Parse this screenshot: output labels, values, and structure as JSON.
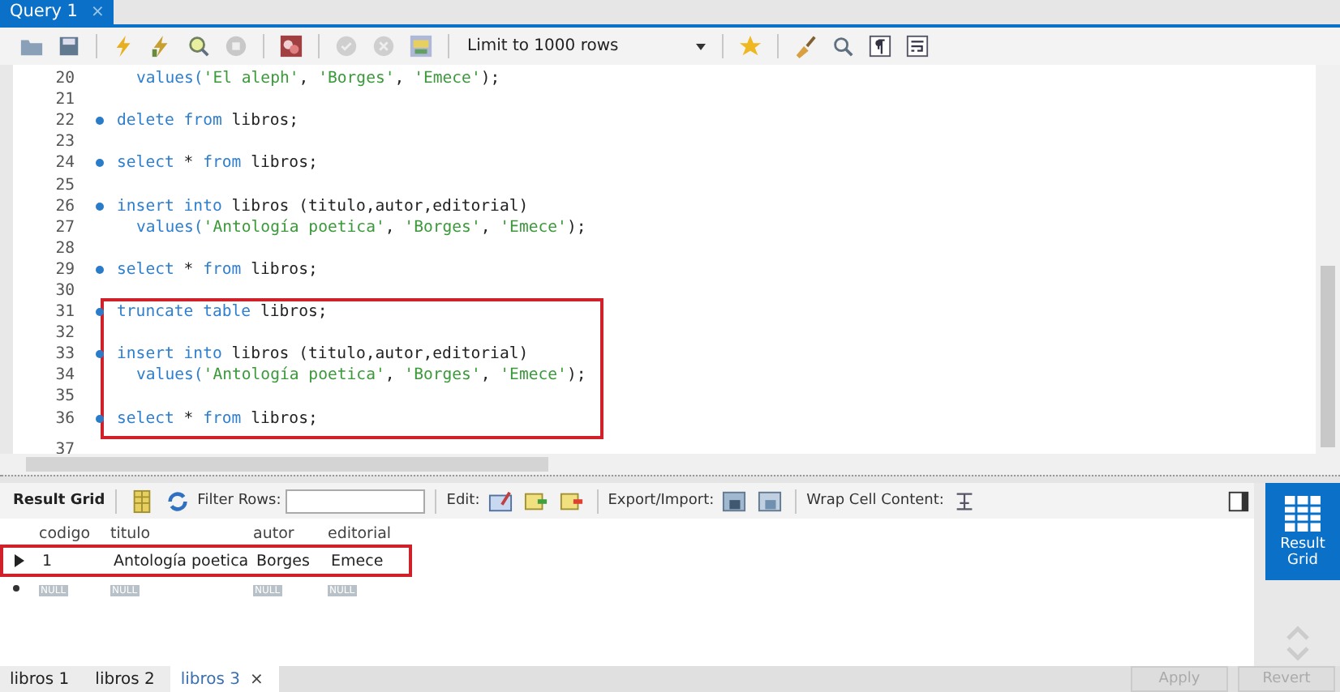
{
  "query_tab": {
    "label": "Query 1",
    "close": "×",
    "selected": true
  },
  "toolbar": {
    "limit": "Limit to 1000 rows"
  },
  "editor": {
    "blocks": [
      {
        "boxed": false,
        "lines": [
          {
            "number": "20",
            "marker": false,
            "indented": true,
            "tokens": [
              {
                "text": "values(",
                "kind": "keyword"
              },
              {
                "text": "'El aleph'",
                "kind": "string"
              },
              {
                "text": ", ",
                "kind": "plain"
              },
              {
                "text": "'Borges'",
                "kind": "string"
              },
              {
                "text": ", ",
                "kind": "plain"
              },
              {
                "text": "'Emece'",
                "kind": "string"
              },
              {
                "text": ");",
                "kind": "plain"
              }
            ]
          },
          {
            "number": "21",
            "marker": false
          },
          {
            "number": "22",
            "marker": true,
            "indented": false,
            "tokens": [
              {
                "text": "delete from",
                "kind": "keyword"
              },
              {
                "text": " libros;",
                "kind": "plain"
              }
            ]
          },
          {
            "number": "23",
            "marker": false
          },
          {
            "number": "24",
            "marker": true,
            "indented": false,
            "tokens": [
              {
                "text": "select",
                "kind": "keyword"
              },
              {
                "text": " * ",
                "kind": "plain"
              },
              {
                "text": "from",
                "kind": "keyword"
              },
              {
                "text": " libros;",
                "kind": "plain"
              }
            ]
          },
          {
            "number": "25",
            "marker": false
          },
          {
            "number": "26",
            "marker": true,
            "indented": false,
            "tokens": [
              {
                "text": "insert into",
                "kind": "keyword"
              },
              {
                "text": " libros (titulo,autor,editorial)",
                "kind": "plain"
              }
            ]
          },
          {
            "number": "27",
            "marker": false,
            "indented": true,
            "tokens": [
              {
                "text": "values(",
                "kind": "keyword"
              },
              {
                "text": "'Antología poetica'",
                "kind": "string"
              },
              {
                "text": ", ",
                "kind": "plain"
              },
              {
                "text": "'Borges'",
                "kind": "string"
              },
              {
                "text": ", ",
                "kind": "plain"
              },
              {
                "text": "'Emece'",
                "kind": "string"
              },
              {
                "text": ");",
                "kind": "plain"
              }
            ]
          },
          {
            "number": "28",
            "marker": false
          },
          {
            "number": "29",
            "marker": true,
            "indented": false,
            "tokens": [
              {
                "text": "select",
                "kind": "keyword"
              },
              {
                "text": " * ",
                "kind": "plain"
              },
              {
                "text": "from",
                "kind": "keyword"
              },
              {
                "text": " libros;",
                "kind": "plain"
              }
            ]
          },
          {
            "number": "30",
            "marker": false
          }
        ]
      },
      {
        "boxed": true,
        "lines": [
          {
            "number": "31",
            "marker": true,
            "indented": false,
            "tokens": [
              {
                "text": "truncate table",
                "kind": "keyword"
              },
              {
                "text": " libros;",
                "kind": "plain"
              }
            ]
          },
          {
            "number": "32",
            "marker": false
          },
          {
            "number": "33",
            "marker": true,
            "indented": false,
            "tokens": [
              {
                "text": "insert into",
                "kind": "keyword"
              },
              {
                "text": " libros (titulo,autor,editorial)",
                "kind": "plain"
              }
            ]
          },
          {
            "number": "34",
            "marker": false,
            "indented": true,
            "tokens": [
              {
                "text": "values(",
                "kind": "keyword"
              },
              {
                "text": "'Antología poetica'",
                "kind": "string"
              },
              {
                "text": ", ",
                "kind": "plain"
              },
              {
                "text": "'Borges'",
                "kind": "string"
              },
              {
                "text": ", ",
                "kind": "plain"
              },
              {
                "text": "'Emece'",
                "kind": "string"
              },
              {
                "text": ");",
                "kind": "plain"
              }
            ]
          },
          {
            "number": "35",
            "marker": false
          },
          {
            "number": "36",
            "marker": true,
            "indented": false,
            "tokens": [
              {
                "text": "select",
                "kind": "keyword"
              },
              {
                "text": " * ",
                "kind": "plain"
              },
              {
                "text": "from",
                "kind": "keyword"
              },
              {
                "text": " libros;",
                "kind": "plain"
              }
            ]
          }
        ]
      },
      {
        "boxed": false,
        "lines": [
          {
            "number": "37",
            "marker": false
          }
        ]
      }
    ]
  },
  "result_toolbar": {
    "title": "Result Grid",
    "filter_label": "Filter Rows:",
    "edit_label": "Edit:",
    "export_label": "Export/Import:",
    "wrap_label": "Wrap Cell Content:"
  },
  "grid": {
    "columns": [
      "codigo",
      "titulo",
      "autor",
      "editorial"
    ],
    "rows": [
      {
        "boxed": true,
        "cells": [
          "1",
          "Antología poetica",
          "Borges",
          "Emece"
        ]
      }
    ],
    "new_row": {
      "cells": [
        "NULL",
        "NULL",
        "NULL",
        "NULL"
      ]
    }
  },
  "side_panel": {
    "label": "Result Grid"
  },
  "result_tabs": [
    {
      "label": "libros 1",
      "selected": false,
      "closable": false
    },
    {
      "label": "libros 2",
      "selected": false,
      "closable": false
    },
    {
      "label": "libros 3",
      "selected": true,
      "closable": true
    }
  ],
  "close_glyph": "×",
  "buttons": [
    {
      "label": "Apply",
      "disabled": true
    },
    {
      "label": "Revert",
      "disabled": true
    }
  ]
}
